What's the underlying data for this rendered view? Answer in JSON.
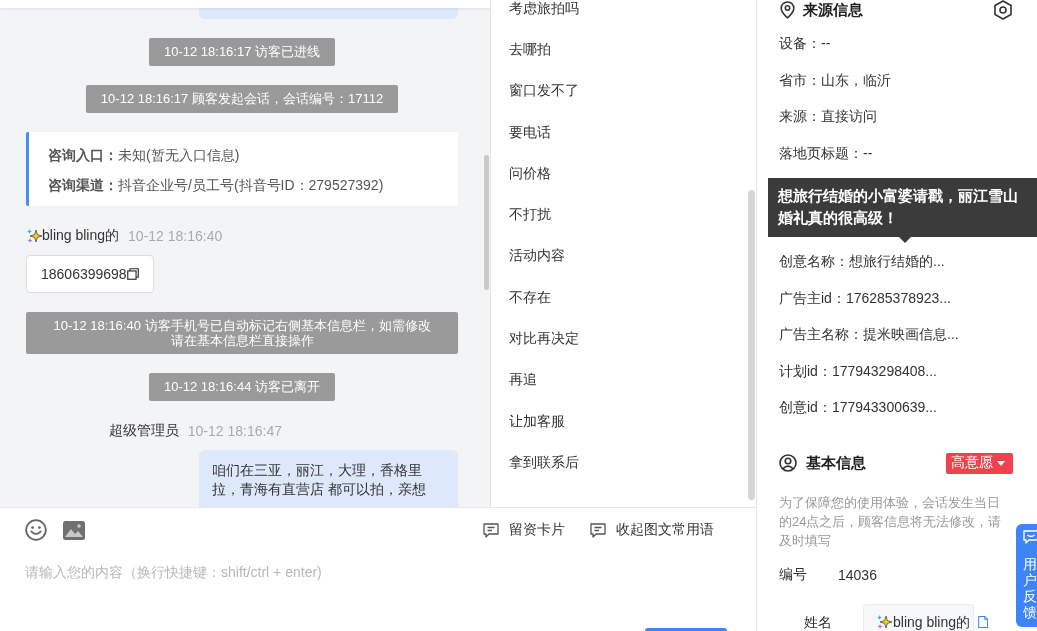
{
  "chat": {
    "partial_bubble_above": true,
    "messages": [
      {
        "kind": "notice",
        "text": "10-12 18:16:17 访客已进线"
      },
      {
        "kind": "notice",
        "text": "10-12 18:16:17 顾客发起会话，会话编号：17112"
      },
      {
        "kind": "entry_card",
        "lines": [
          "**咨询入口：**未知(暂无入口信息)",
          "**咨询渠道：**抖音企业号/员工号(抖音号ID：279527392)"
        ]
      },
      {
        "kind": "visitor",
        "sender": "bling bling的",
        "time": "10-12 18:16:40",
        "text": "18606399698"
      },
      {
        "kind": "notice",
        "text": "10-12 18:16:40 访客手机号已自动标记右侧基本信息栏，如需修改请在基本信息栏直接操作"
      },
      {
        "kind": "notice",
        "text": "10-12 18:16:44 访客已离开"
      },
      {
        "kind": "agent",
        "sender": "超级管理员",
        "time": "10-12 18:16:47",
        "text": "咱们在三亚，丽江，大理，香格里拉，青海有直营店 都可以拍，亲想"
      }
    ]
  },
  "quick_replies": {
    "items": [
      "考虑旅拍吗",
      "去哪拍",
      "窗口发不了",
      "要电话",
      "问价格",
      "不打扰",
      "活动内容",
      "不存在",
      "对比再决定",
      "再追",
      "让加客服",
      "拿到联系后"
    ]
  },
  "composer": {
    "tools": [
      "留资卡片",
      "收起图文常用语"
    ],
    "placeholder": "请输入您的内容（换行快捷键：shift/ctrl + enter)"
  },
  "source_info": {
    "title": "来源信息",
    "rows": [
      {
        "kind": "field",
        "text": "设备：--"
      },
      {
        "kind": "field",
        "text": "省市：山东，临沂"
      },
      {
        "kind": "field",
        "text": "来源：直接访问"
      },
      {
        "kind": "field",
        "text": "落地页标题：--"
      },
      {
        "kind": "tooltip",
        "text": "想旅行结婚的小富婆请戳，丽江雪山婚礼真的很高级！"
      },
      {
        "kind": "field",
        "text": "创意名称：想旅行结婚的..."
      },
      {
        "kind": "field",
        "text": "广告主id：176285378923..."
      },
      {
        "kind": "field",
        "text": "广告主名称：提米映画信息..."
      },
      {
        "kind": "field",
        "text": "计划id：177943298408..."
      },
      {
        "kind": "field",
        "text": "创意id：177943300639..."
      }
    ]
  },
  "basic_info": {
    "title": "基本信息",
    "intent": "高意愿",
    "note": "为了保障您的使用体验，会话发生当日的24点之后，顾客信息将无法修改，请及时填写",
    "fields": [
      {
        "kind": "text",
        "label": "编号",
        "value": "14036"
      },
      {
        "kind": "input",
        "label": "姓名",
        "value": "bling bling的"
      }
    ]
  },
  "feedback_tab": {
    "label": "用户反馈"
  }
}
